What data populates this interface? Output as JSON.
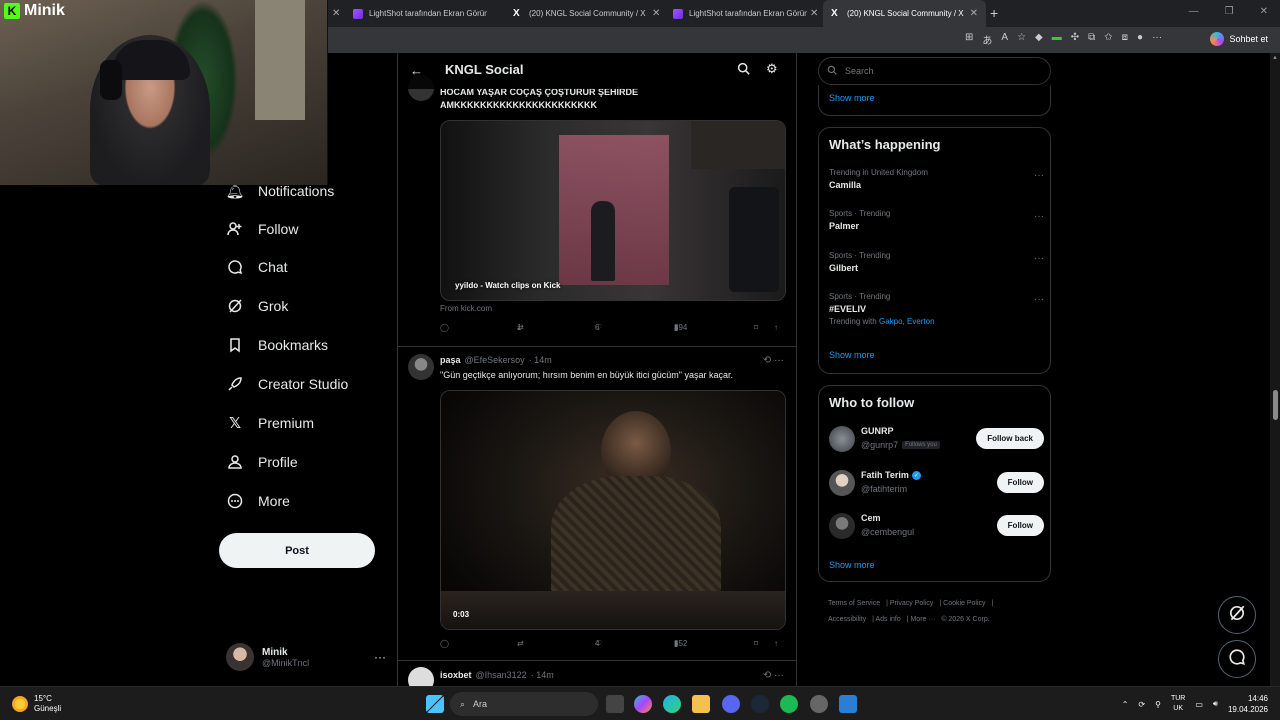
{
  "browser": {
    "tabs": [
      {
        "title": "LightShot tarafından Ekran Görünt",
        "favicon": "lightshot-icon",
        "active": false
      },
      {
        "title": "(20) KNGL Social Community / X",
        "favicon": "x-icon",
        "active": false
      },
      {
        "title": "LightShot tarafından Ekran Görünt",
        "favicon": "lightshot-icon",
        "active": false
      },
      {
        "title": "(20) KNGL Social Community / X",
        "favicon": "x-icon",
        "active": true
      }
    ],
    "copilot_label": "Sohbet et"
  },
  "overlay": {
    "brand": "Minik"
  },
  "nav": {
    "items": [
      {
        "label": "Notifications",
        "icon": "bell-icon"
      },
      {
        "label": "Follow",
        "icon": "add-person-icon"
      },
      {
        "label": "Chat",
        "icon": "chat-icon"
      },
      {
        "label": "Grok",
        "icon": "grok-icon"
      },
      {
        "label": "Bookmarks",
        "icon": "bookmark-icon"
      },
      {
        "label": "Creator Studio",
        "icon": "rocket-icon"
      },
      {
        "label": "Premium",
        "icon": "x-logo-icon"
      },
      {
        "label": "Profile",
        "icon": "person-icon"
      },
      {
        "label": "More",
        "icon": "more-circle-icon"
      }
    ],
    "post_label": "Post",
    "account": {
      "name": "Minik",
      "handle": "@MinikTncl"
    }
  },
  "feed": {
    "title": "KNGL Social",
    "tweets": [
      {
        "text": "HOCAM YAŞAR COÇAŞ ÇOŞTURUR ŞEHİRDE AMKKKKKKKKKKKKKKKKKKKKKK",
        "media_caption": "yyildo - Watch clips on Kick",
        "source": "From kick.com",
        "stats": {
          "replies": "",
          "reposts": "1",
          "likes": "6",
          "views": "394"
        }
      },
      {
        "name": "paşa",
        "handle": "@EfeSekersoy",
        "time": "· 14m",
        "text": "\"Gün geçtikçe anlıyorum; hırsım benim en büyük itici gücüm\" yaşar kaçar.",
        "video_time": "0:03",
        "stats": {
          "replies": "",
          "reposts": "",
          "likes": "4",
          "views": "352"
        }
      },
      {
        "name": "isoxbet",
        "handle": "@Ihsan3122",
        "time": "· 14m"
      }
    ]
  },
  "sidebar": {
    "search_placeholder": "Search",
    "show_more": "Show more",
    "happening": {
      "title": "What’s happening",
      "trends": [
        {
          "meta": "Trending in United Kingdom",
          "topic": "Camilla"
        },
        {
          "meta": "Sports · Trending",
          "topic": "Palmer"
        },
        {
          "meta": "Sports · Trending",
          "topic": "Gilbert"
        },
        {
          "meta": "Sports · Trending",
          "topic": "#EVELIV",
          "with_prefix": "Trending with",
          "with_links": "Gakpo, Everton"
        }
      ]
    },
    "who_to_follow": {
      "title": "Who to follow",
      "people": [
        {
          "name": "GUNRP",
          "handle": "@gunrp7",
          "badge": "Follows you",
          "button": "Follow back"
        },
        {
          "name": "Fatih Terim",
          "handle": "@fatihterim",
          "verified": true,
          "button": "Follow"
        },
        {
          "name": "Cem",
          "handle": "@cembengul",
          "button": "Follow"
        }
      ]
    },
    "footer_links": [
      "Terms of Service",
      "Privacy Policy",
      "Cookie Policy",
      "Accessibility",
      "Ads info",
      "More ···",
      "© 2026 X Corp."
    ]
  },
  "taskbar": {
    "weather_temp": "15°C",
    "weather_desc": "Güneşli",
    "search_label": "Ara",
    "lang_top": "TUR",
    "lang_bottom": "UK",
    "time": "14:46",
    "date": "19.04.2026"
  },
  "colors": {
    "accent": "#1d9bf0",
    "background": "#000000",
    "border": "#2f3336"
  }
}
